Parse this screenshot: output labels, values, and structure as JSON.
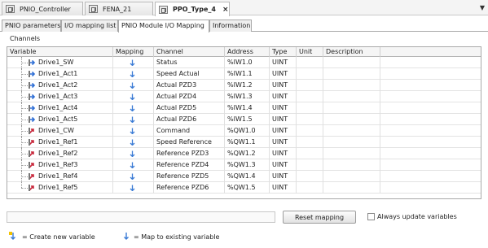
{
  "doc_tabs": [
    {
      "label": "PNIO_Controller",
      "active": false
    },
    {
      "label": "FENA_21",
      "active": false
    },
    {
      "label": "PPO_Type_4",
      "active": true
    }
  ],
  "doc_tab_close": "×",
  "doc_tabs_menu": "▼",
  "editor_tabs": [
    {
      "label": "PNIO parameters",
      "active": false
    },
    {
      "label": "I/O mapping list",
      "active": false
    },
    {
      "label": "PNIO Module I/O Mapping",
      "active": true
    },
    {
      "label": "Information",
      "active": false
    }
  ],
  "section_label": "Channels",
  "columns": [
    "Variable",
    "Mapping",
    "Channel",
    "Address",
    "Type",
    "Unit",
    "Description"
  ],
  "rows": [
    {
      "variable": "Drive1_SW",
      "channel": "Status",
      "address": "%IW1.0",
      "type": "UINT",
      "unit": "",
      "description": "",
      "direction": "input"
    },
    {
      "variable": "Drive1_Act1",
      "channel": "Speed Actual",
      "address": "%IW1.1",
      "type": "UINT",
      "unit": "",
      "description": "",
      "direction": "input"
    },
    {
      "variable": "Drive1_Act2",
      "channel": "Actual PZD3",
      "address": "%IW1.2",
      "type": "UINT",
      "unit": "",
      "description": "",
      "direction": "input"
    },
    {
      "variable": "Drive1_Act3",
      "channel": "Actual PZD4",
      "address": "%IW1.3",
      "type": "UINT",
      "unit": "",
      "description": "",
      "direction": "input"
    },
    {
      "variable": "Drive1_Act4",
      "channel": "Actual PZD5",
      "address": "%IW1.4",
      "type": "UINT",
      "unit": "",
      "description": "",
      "direction": "input"
    },
    {
      "variable": "Drive1_Act5",
      "channel": "Actual PZD6",
      "address": "%IW1.5",
      "type": "UINT",
      "unit": "",
      "description": "",
      "direction": "input"
    },
    {
      "variable": "Drive1_CW",
      "channel": "Command",
      "address": "%QW1.0",
      "type": "UINT",
      "unit": "",
      "description": "",
      "direction": "output"
    },
    {
      "variable": "Drive1_Ref1",
      "channel": "Speed Reference",
      "address": "%QW1.1",
      "type": "UINT",
      "unit": "",
      "description": "",
      "direction": "output"
    },
    {
      "variable": "Drive1_Ref2",
      "channel": "Reference PZD3",
      "address": "%QW1.2",
      "type": "UINT",
      "unit": "",
      "description": "",
      "direction": "output"
    },
    {
      "variable": "Drive1_Ref3",
      "channel": "Reference PZD4",
      "address": "%QW1.3",
      "type": "UINT",
      "unit": "",
      "description": "",
      "direction": "output"
    },
    {
      "variable": "Drive1_Ref4",
      "channel": "Reference PZD5",
      "address": "%QW1.4",
      "type": "UINT",
      "unit": "",
      "description": "",
      "direction": "output"
    },
    {
      "variable": "Drive1_Ref5",
      "channel": "Reference PZD6",
      "address": "%QW1.5",
      "type": "UINT",
      "unit": "",
      "description": "",
      "direction": "output"
    }
  ],
  "reset_button": "Reset mapping",
  "always_update_label": "Always update variables",
  "always_update_checked": false,
  "legend": {
    "create_new": "= Create new variable",
    "map_existing": "= Map to existing variable"
  },
  "colors": {
    "input_arrow": "#2f6fd6",
    "output_arrow": "#c8283c",
    "mapping_icon": "#3a7bd5"
  }
}
